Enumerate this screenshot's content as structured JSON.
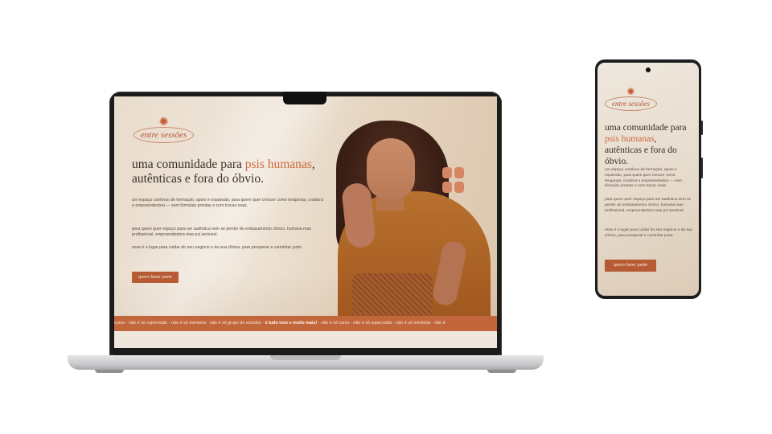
{
  "brand": {
    "name": "entre sessões",
    "icon": "sun-icon"
  },
  "hero": {
    "headline_pre": "uma comunidade para ",
    "headline_accent": "psis humanas",
    "headline_post": ", autênticas e fora do óbvio.",
    "p1_a": "um espaço contínuo de formação, apoio e expansão, para quem quer crescer como ",
    "p1_b": "terapeuta, criadora e empreendedora — sem fórmulas prontas e com trocas reais.",
    "p2": "para quem quer espaço para ser autêntica sem se perder do embasamento clínico, humana mas profissional, empreendedora mas psi sensível.",
    "p3": "esse é o lugar para cuidar do seu negócio e da sua clínica, para prosperar e caminhar junto.",
    "cta_label": "quero fazer parte"
  },
  "ticker": {
    "text_a": "curso · não é só supervisão · não é só mentoria · não é só grupo de estudos · ",
    "text_bold": "é tudo isso e muito mais!",
    "text_b": " · não é só curso · não é só supervisão · não é só mentoria · não é"
  },
  "colors": {
    "accent": "#cc6b3e",
    "button": "#b65b33",
    "ticker_bg": "#c2673b",
    "text": "#3b2e26"
  }
}
